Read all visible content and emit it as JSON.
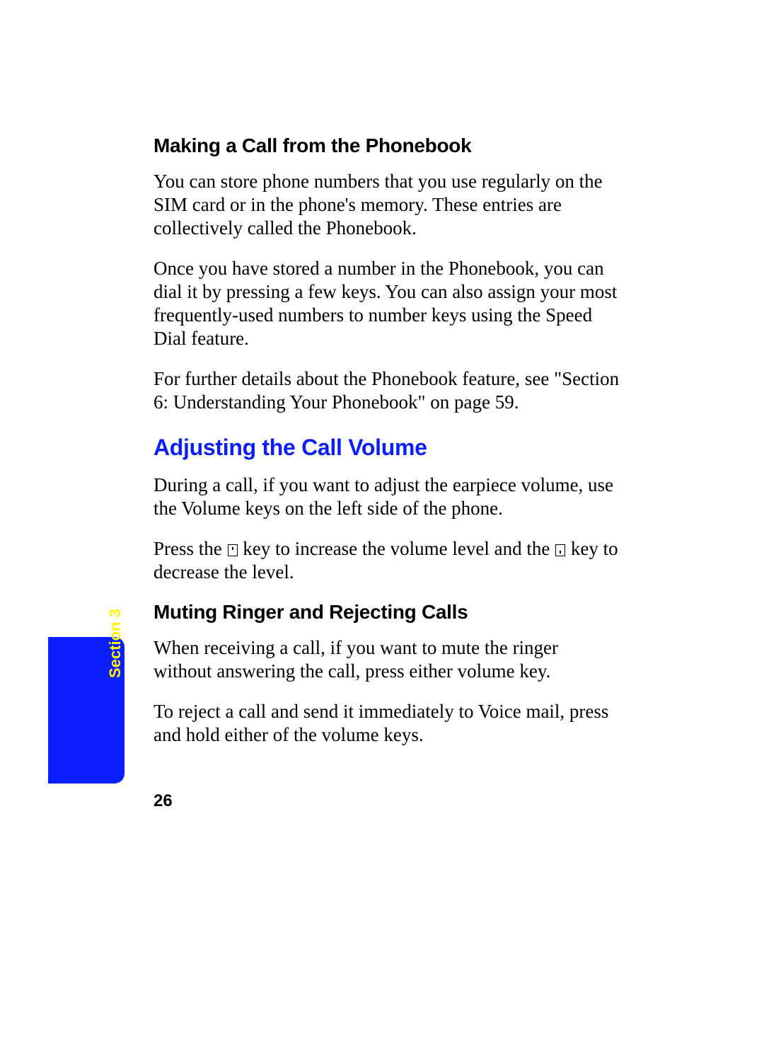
{
  "headings": {
    "h1": "Making a Call from the Phonebook",
    "h2": "Adjusting the Call Volume",
    "h3": "Muting Ringer and Rejecting Calls"
  },
  "paras": {
    "p1": "You can store phone numbers that you use regularly on the SIM card or in the phone's memory. These entries are collectively called the Phonebook.",
    "p2": "Once you have stored a number in the Phonebook, you can dial it by pressing a few keys. You can also assign your most frequently-used numbers to number keys using the Speed Dial feature.",
    "p3": "For further details about the Phonebook feature, see \"Section 6: Understanding Your Phonebook\" on page 59.",
    "p4": "During a call, if you want to adjust the earpiece volume, use the Volume keys on the left side of the phone.",
    "p5_pre": "Press the ",
    "p5_mid": " key to increase the volume level and the ",
    "p5_post": " key to decrease the level.",
    "p6": "When receiving a call, if you want to mute the ringer without answering the call, press either volume key.",
    "p7": "To reject a call and send it immediately to Voice mail, press and hold either of the volume keys."
  },
  "tab": {
    "label": "Section 3"
  },
  "page_number": "26"
}
